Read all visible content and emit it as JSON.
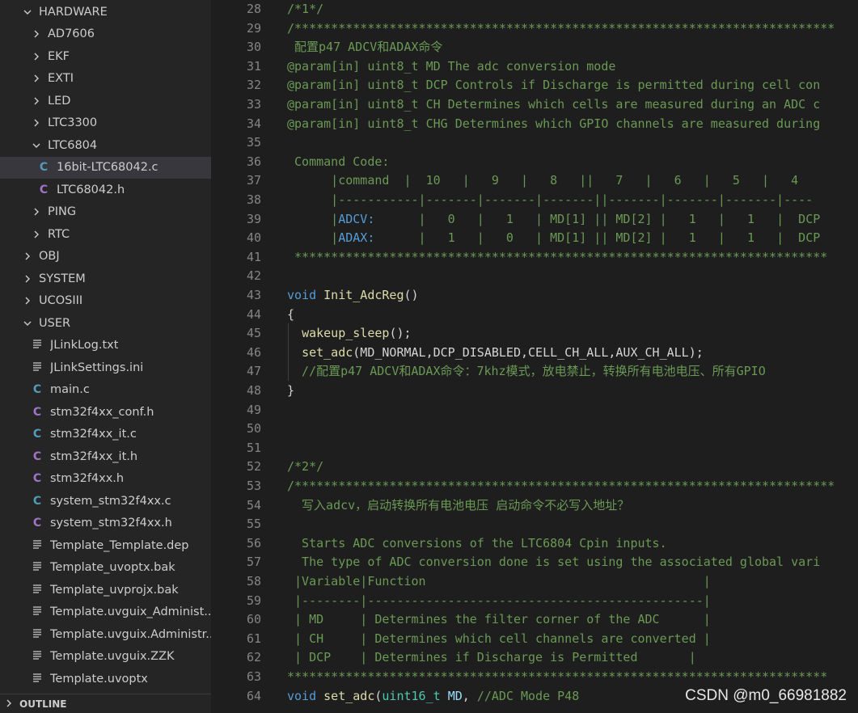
{
  "sidebar": {
    "items": [
      {
        "label": "HARDWARE",
        "type": "folder",
        "open": true,
        "depth": 0
      },
      {
        "label": "AD7606",
        "type": "folder",
        "open": false,
        "depth": 1
      },
      {
        "label": "EKF",
        "type": "folder",
        "open": false,
        "depth": 1
      },
      {
        "label": "EXTI",
        "type": "folder",
        "open": false,
        "depth": 1
      },
      {
        "label": "LED",
        "type": "folder",
        "open": false,
        "depth": 1
      },
      {
        "label": "LTC3300",
        "type": "folder",
        "open": false,
        "depth": 1
      },
      {
        "label": "LTC6804",
        "type": "folder",
        "open": true,
        "depth": 1
      },
      {
        "label": "16bit-LTC68042.c",
        "type": "c",
        "depth": 2,
        "selected": true
      },
      {
        "label": "LTC68042.h",
        "type": "h",
        "depth": 2
      },
      {
        "label": "PING",
        "type": "folder",
        "open": false,
        "depth": 1
      },
      {
        "label": "RTC",
        "type": "folder",
        "open": false,
        "depth": 1
      },
      {
        "label": "OBJ",
        "type": "folder",
        "open": false,
        "depth": 0
      },
      {
        "label": "SYSTEM",
        "type": "folder",
        "open": false,
        "depth": 0
      },
      {
        "label": "UCOSIII",
        "type": "folder",
        "open": false,
        "depth": 0
      },
      {
        "label": "USER",
        "type": "folder",
        "open": true,
        "depth": 0
      },
      {
        "label": "JLinkLog.txt",
        "type": "txt",
        "depth": 1
      },
      {
        "label": "JLinkSettings.ini",
        "type": "txt",
        "depth": 1
      },
      {
        "label": "main.c",
        "type": "c",
        "depth": 1
      },
      {
        "label": "stm32f4xx_conf.h",
        "type": "h",
        "depth": 1
      },
      {
        "label": "stm32f4xx_it.c",
        "type": "c",
        "depth": 1
      },
      {
        "label": "stm32f4xx_it.h",
        "type": "h",
        "depth": 1
      },
      {
        "label": "stm32f4xx.h",
        "type": "h",
        "depth": 1
      },
      {
        "label": "system_stm32f4xx.c",
        "type": "c",
        "depth": 1
      },
      {
        "label": "system_stm32f4xx.h",
        "type": "h",
        "depth": 1
      },
      {
        "label": "Template_Template.dep",
        "type": "txt",
        "depth": 1
      },
      {
        "label": "Template_uvoptx.bak",
        "type": "txt",
        "depth": 1
      },
      {
        "label": "Template_uvprojx.bak",
        "type": "txt",
        "depth": 1
      },
      {
        "label": "Template.uvguix_Administ...",
        "type": "txt",
        "depth": 1
      },
      {
        "label": "Template.uvguix.Administr...",
        "type": "txt",
        "depth": 1
      },
      {
        "label": "Template.uvguix.ZZK",
        "type": "txt",
        "depth": 1
      },
      {
        "label": "Template.uvoptx",
        "type": "txt",
        "depth": 1
      }
    ],
    "outline_label": "OUTLINE"
  },
  "icons": {
    "chevron_right": "chevron-right-icon",
    "chevron_down": "chevron-down-icon",
    "c_file": "c-file-icon",
    "h_file": "h-file-icon",
    "text_file": "text-file-icon"
  },
  "colors": {
    "comment": "#6a9955",
    "keyword": "#569cd6",
    "function": "#dcdcaa",
    "background": "#1e1e1e",
    "sidebar": "#252526"
  },
  "editor": {
    "lines": [
      {
        "n": "28",
        "indent": 0,
        "tokens": [
          {
            "t": "/*1*/",
            "c": "c"
          }
        ]
      },
      {
        "n": "29",
        "indent": 0,
        "tokens": [
          {
            "t": "/**************************************************************************",
            "c": "c"
          }
        ]
      },
      {
        "n": "30",
        "indent": 0,
        "tokens": [
          {
            "t": " 配置p47 ADCV和ADAX命令",
            "c": "c"
          }
        ]
      },
      {
        "n": "31",
        "indent": 0,
        "tokens": [
          {
            "t": "@param[in] uint8_t MD The adc conversion mode",
            "c": "c"
          }
        ]
      },
      {
        "n": "32",
        "indent": 0,
        "tokens": [
          {
            "t": "@param[in] uint8_t DCP Controls if Discharge is permitted during cell con",
            "c": "c"
          }
        ]
      },
      {
        "n": "33",
        "indent": 0,
        "tokens": [
          {
            "t": "@param[in] uint8_t CH Determines which cells are measured during an ADC c",
            "c": "c"
          }
        ]
      },
      {
        "n": "34",
        "indent": 0,
        "tokens": [
          {
            "t": "@param[in] uint8_t CHG Determines which GPIO channels are measured during",
            "c": "c"
          }
        ]
      },
      {
        "n": "35",
        "indent": 0,
        "tokens": []
      },
      {
        "n": "36",
        "indent": 0,
        "tokens": [
          {
            "t": " Command Code:",
            "c": "c"
          }
        ]
      },
      {
        "n": "37",
        "indent": 0,
        "tokens": [
          {
            "t": "      |command  |  10   |   9   |   8   ||   7   |   6   |   5   |   4",
            "c": "c"
          }
        ]
      },
      {
        "n": "38",
        "indent": 0,
        "tokens": [
          {
            "t": "      |-----------|-------|-------|-------||-------|-------|-------|----",
            "c": "c"
          }
        ]
      },
      {
        "n": "39",
        "indent": 0,
        "tokens": [
          {
            "t": "      |",
            "c": "c"
          },
          {
            "t": "ADCV:",
            "c": "hl"
          },
          {
            "t": "      |   0   |   1   | MD[1] || MD[2] |   1   |   1   |  DCP",
            "c": "c"
          }
        ]
      },
      {
        "n": "40",
        "indent": 0,
        "tokens": [
          {
            "t": "      |",
            "c": "c"
          },
          {
            "t": "ADAX:",
            "c": "hl"
          },
          {
            "t": "      |   1   |   0   | MD[1] || MD[2] |   1   |   1   |  DCP",
            "c": "c"
          }
        ]
      },
      {
        "n": "41",
        "indent": 0,
        "tokens": [
          {
            "t": " *************************************************************************",
            "c": "c"
          }
        ]
      },
      {
        "n": "42",
        "indent": 0,
        "tokens": []
      },
      {
        "n": "43",
        "indent": 0,
        "tokens": [
          {
            "t": "void",
            "c": "k"
          },
          {
            "t": " ",
            "c": "p"
          },
          {
            "t": "Init_AdcReg",
            "c": "f"
          },
          {
            "t": "()",
            "c": "p"
          }
        ]
      },
      {
        "n": "44",
        "indent": 0,
        "tokens": [
          {
            "t": "{",
            "c": "p"
          }
        ]
      },
      {
        "n": "45",
        "indent": 1,
        "tokens": [
          {
            "t": "  ",
            "c": "p"
          },
          {
            "t": "wakeup_sleep",
            "c": "f"
          },
          {
            "t": "();",
            "c": "p"
          }
        ]
      },
      {
        "n": "46",
        "indent": 1,
        "tokens": [
          {
            "t": "  ",
            "c": "p"
          },
          {
            "t": "set_adc",
            "c": "f"
          },
          {
            "t": "(MD_NORMAL,DCP_DISABLED,CELL_CH_ALL,AUX_CH_ALL);",
            "c": "p"
          }
        ]
      },
      {
        "n": "47",
        "indent": 1,
        "tokens": [
          {
            "t": "  //配置p47 ADCV和ADAX命令：7khz模式，放电禁止，转换所有电池电压、所有GPIO",
            "c": "c"
          }
        ]
      },
      {
        "n": "48",
        "indent": 0,
        "tokens": [
          {
            "t": "}",
            "c": "p"
          }
        ]
      },
      {
        "n": "49",
        "indent": 0,
        "tokens": []
      },
      {
        "n": "50",
        "indent": 0,
        "tokens": []
      },
      {
        "n": "51",
        "indent": 0,
        "tokens": []
      },
      {
        "n": "52",
        "indent": 0,
        "tokens": [
          {
            "t": "/*2*/",
            "c": "c"
          }
        ]
      },
      {
        "n": "53",
        "indent": 0,
        "tokens": [
          {
            "t": "/**************************************************************************",
            "c": "c"
          }
        ]
      },
      {
        "n": "54",
        "indent": 0,
        "tokens": [
          {
            "t": "  写入adcv，启动转换所有电池电压 启动命令不必写入地址？",
            "c": "c"
          }
        ]
      },
      {
        "n": "55",
        "indent": 0,
        "tokens": []
      },
      {
        "n": "56",
        "indent": 0,
        "tokens": [
          {
            "t": "  Starts ADC conversions of the LTC6804 Cpin inputs.",
            "c": "c"
          }
        ]
      },
      {
        "n": "57",
        "indent": 0,
        "tokens": [
          {
            "t": "  The type of ADC conversion done is set using the associated global vari",
            "c": "c"
          }
        ]
      },
      {
        "n": "58",
        "indent": 0,
        "tokens": [
          {
            "t": " |Variable|Function                                      |",
            "c": "c"
          }
        ]
      },
      {
        "n": "59",
        "indent": 0,
        "tokens": [
          {
            "t": " |--------|----------------------------------------------|",
            "c": "c"
          }
        ]
      },
      {
        "n": "60",
        "indent": 0,
        "tokens": [
          {
            "t": " | MD     | Determines the filter corner of the ADC      |",
            "c": "c"
          }
        ]
      },
      {
        "n": "61",
        "indent": 0,
        "tokens": [
          {
            "t": " | CH     | Determines which cell channels are converted |",
            "c": "c"
          }
        ]
      },
      {
        "n": "62",
        "indent": 0,
        "tokens": [
          {
            "t": " | DCP    | Determines if Discharge is Permitted       |",
            "c": "c"
          }
        ]
      },
      {
        "n": "63",
        "indent": 0,
        "tokens": [
          {
            "t": "**************************************************************************",
            "c": "c"
          }
        ]
      },
      {
        "n": "64",
        "indent": 0,
        "tokens": [
          {
            "t": "void",
            "c": "k"
          },
          {
            "t": " ",
            "c": "p"
          },
          {
            "t": "set_adc",
            "c": "f"
          },
          {
            "t": "(",
            "c": "p"
          },
          {
            "t": "uint16_t",
            "c": "t"
          },
          {
            "t": " ",
            "c": "p"
          },
          {
            "t": "MD",
            "c": "a"
          },
          {
            "t": ", ",
            "c": "p"
          },
          {
            "t": "//ADC Mode P48",
            "c": "c"
          }
        ]
      }
    ]
  },
  "watermark": "CSDN @m0_66981882"
}
